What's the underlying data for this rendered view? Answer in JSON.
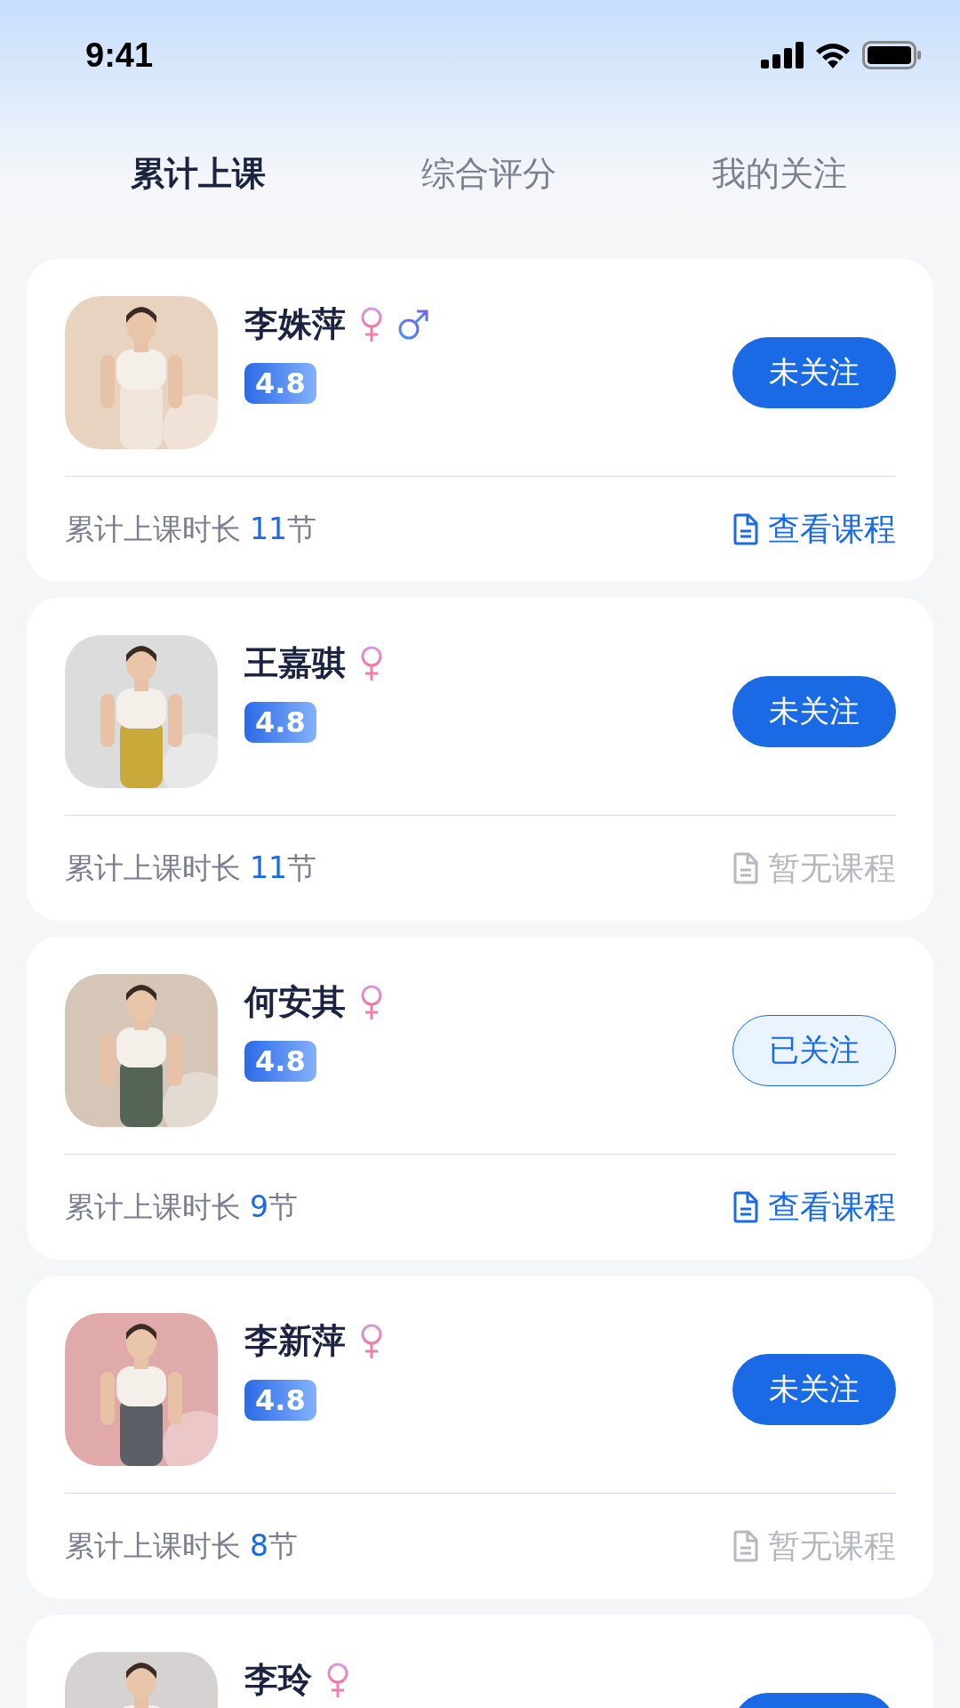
{
  "status_bar": {
    "time": "9:41"
  },
  "tabs": [
    {
      "label": "累计上课",
      "selected": true
    },
    {
      "label": "综合评分",
      "selected": false
    },
    {
      "label": "我的关注",
      "selected": false
    }
  ],
  "coaches": [
    {
      "name": "李姝萍",
      "genders": [
        {
          "kind": "female"
        },
        {
          "kind": "male"
        }
      ],
      "rating": "4.8",
      "follow": {
        "label": "未关注",
        "followed": false
      },
      "lessons_label": "累计上课时长",
      "lessons_count": "11",
      "lessons_unit": "节",
      "course": {
        "label": "查看课程",
        "available": true
      }
    },
    {
      "name": "王嘉骐",
      "genders": [
        {
          "kind": "female"
        }
      ],
      "rating": "4.8",
      "follow": {
        "label": "未关注",
        "followed": false
      },
      "lessons_label": "累计上课时长",
      "lessons_count": "11",
      "lessons_unit": "节",
      "course": {
        "label": "暂无课程",
        "available": false
      }
    },
    {
      "name": "何安其",
      "genders": [
        {
          "kind": "female"
        }
      ],
      "rating": "4.8",
      "follow": {
        "label": "已关注",
        "followed": true
      },
      "lessons_label": "累计上课时长",
      "lessons_count": "9",
      "lessons_unit": "节",
      "course": {
        "label": "查看课程",
        "available": true
      }
    },
    {
      "name": "李新萍",
      "genders": [
        {
          "kind": "female"
        }
      ],
      "rating": "4.8",
      "follow": {
        "label": "未关注",
        "followed": false
      },
      "lessons_label": "累计上课时长",
      "lessons_count": "8",
      "lessons_unit": "节",
      "course": {
        "label": "暂无课程",
        "available": false
      }
    },
    {
      "name": "李玲",
      "genders": [
        {
          "kind": "female"
        }
      ],
      "follow": {
        "followed": false
      }
    }
  ]
}
